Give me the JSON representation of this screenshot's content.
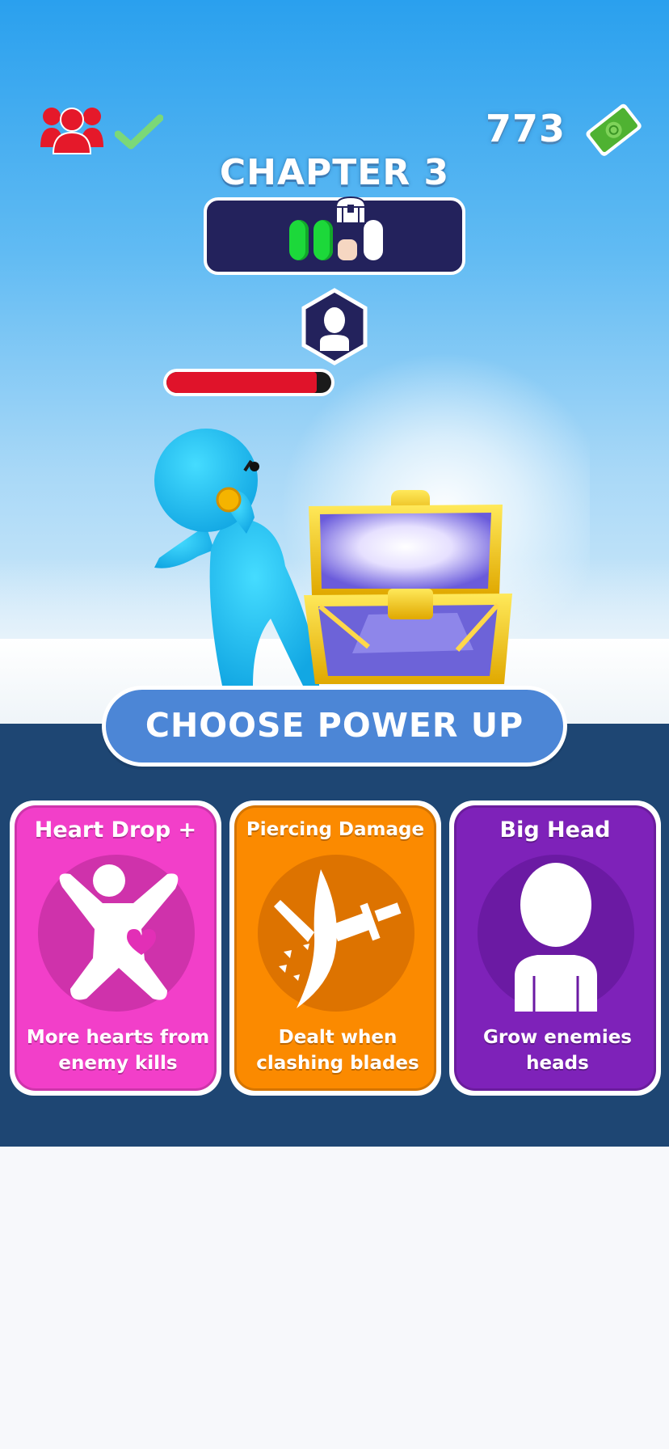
{
  "hud": {
    "players_icon": "three-people-icon",
    "players_status_icon": "checkmark-icon",
    "coins": "773",
    "cash_icon": "cash-bill-icon"
  },
  "chapter": {
    "title": "CHAPTER 3",
    "stages": [
      "done",
      "done",
      "current",
      "todo"
    ],
    "reward_icon": "treasure-chest-icon"
  },
  "enemy": {
    "badge_icon": "enemy-avatar-icon",
    "health_fraction": 0.91
  },
  "powerup": {
    "heading": "CHOOSE POWER UP",
    "cards": [
      {
        "title": "Heart Drop +",
        "desc_line1": "More hearts from",
        "desc_line2": "enemy kills",
        "icon": "heart-figure-icon",
        "color": "#f23fc9",
        "circle_color": "#cf32ab"
      },
      {
        "title": "Piercing Damage",
        "desc_line1": "Dealt when",
        "desc_line2": "clashing blades",
        "icon": "sword-slash-icon",
        "color": "#fb8a00",
        "circle_color": "#dd7300"
      },
      {
        "title": "Big Head",
        "desc_line1": "Grow enemies",
        "desc_line2": "heads",
        "icon": "big-head-figure-icon",
        "color": "#7e22b9",
        "circle_color": "#6b1aa3"
      }
    ]
  }
}
